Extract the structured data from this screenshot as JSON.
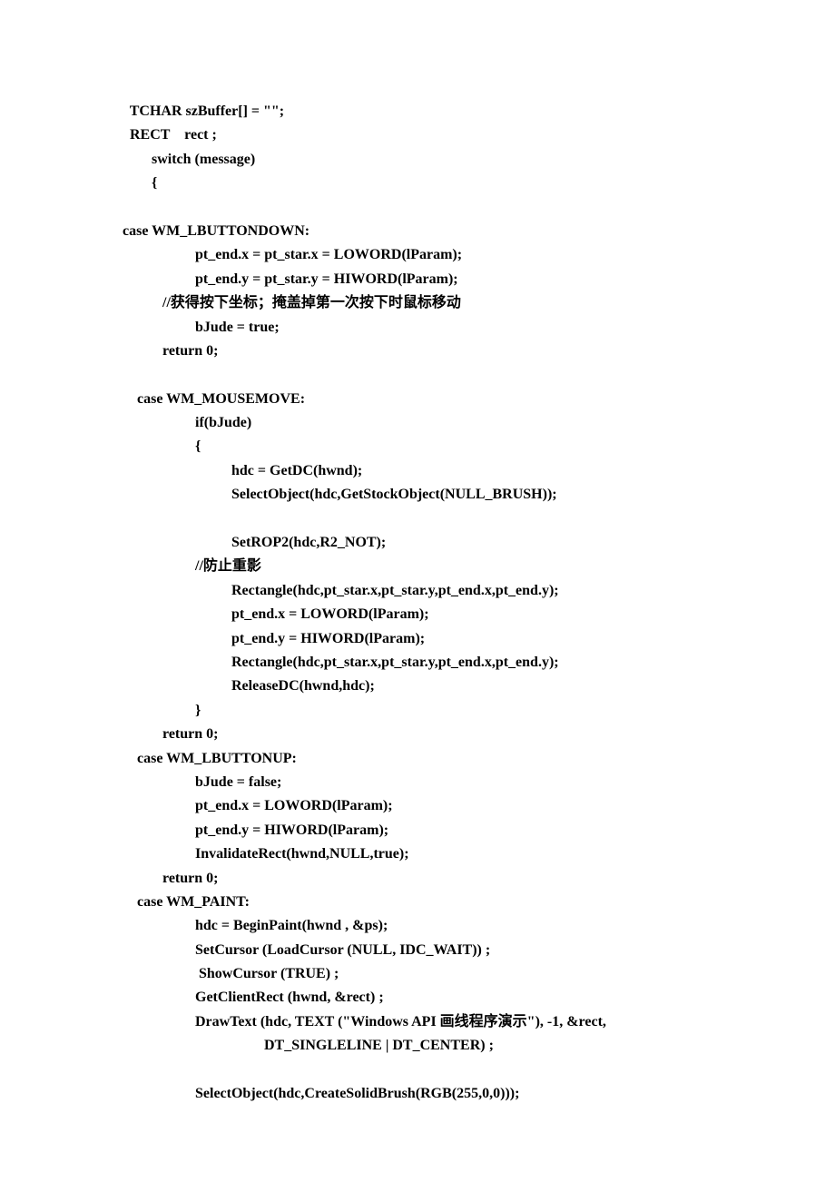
{
  "code": {
    "lines": [
      "  TCHAR szBuffer[] = \"\";",
      "  RECT    rect ;",
      "        switch (message)",
      "        {",
      "",
      "case WM_LBUTTONDOWN:",
      "                    pt_end.x = pt_star.x = LOWORD(lParam);",
      "                    pt_end.y = pt_star.y = HIWORD(lParam);",
      "           //获得按下坐标；掩盖掉第一次按下时鼠标移动",
      "                    bJude = true;",
      "           return 0;",
      "",
      "    case WM_MOUSEMOVE:",
      "                    if(bJude)",
      "                    {",
      "                              hdc = GetDC(hwnd);",
      "                              SelectObject(hdc,GetStockObject(NULL_BRUSH));",
      "",
      "                              SetROP2(hdc,R2_NOT);",
      "                    //防止重影",
      "                              Rectangle(hdc,pt_star.x,pt_star.y,pt_end.x,pt_end.y);",
      "                              pt_end.x = LOWORD(lParam);",
      "                              pt_end.y = HIWORD(lParam);",
      "                              Rectangle(hdc,pt_star.x,pt_star.y,pt_end.x,pt_end.y);",
      "                              ReleaseDC(hwnd,hdc);",
      "                    }",
      "           return 0;",
      "    case WM_LBUTTONUP:",
      "                    bJude = false;",
      "                    pt_end.x = LOWORD(lParam);",
      "                    pt_end.y = HIWORD(lParam);",
      "                    InvalidateRect(hwnd,NULL,true);",
      "           return 0;",
      "    case WM_PAINT:",
      "                    hdc = BeginPaint(hwnd , &ps);",
      "                    SetCursor (LoadCursor (NULL, IDC_WAIT)) ;",
      "                     ShowCursor (TRUE) ;",
      "                    GetClientRect (hwnd, &rect) ;",
      "                    DrawText (hdc, TEXT (\"Windows API 画线程序演示\"), -1, &rect,",
      "                                       DT_SINGLELINE | DT_CENTER) ;",
      "",
      "                    SelectObject(hdc,CreateSolidBrush(RGB(255,0,0)));"
    ]
  }
}
